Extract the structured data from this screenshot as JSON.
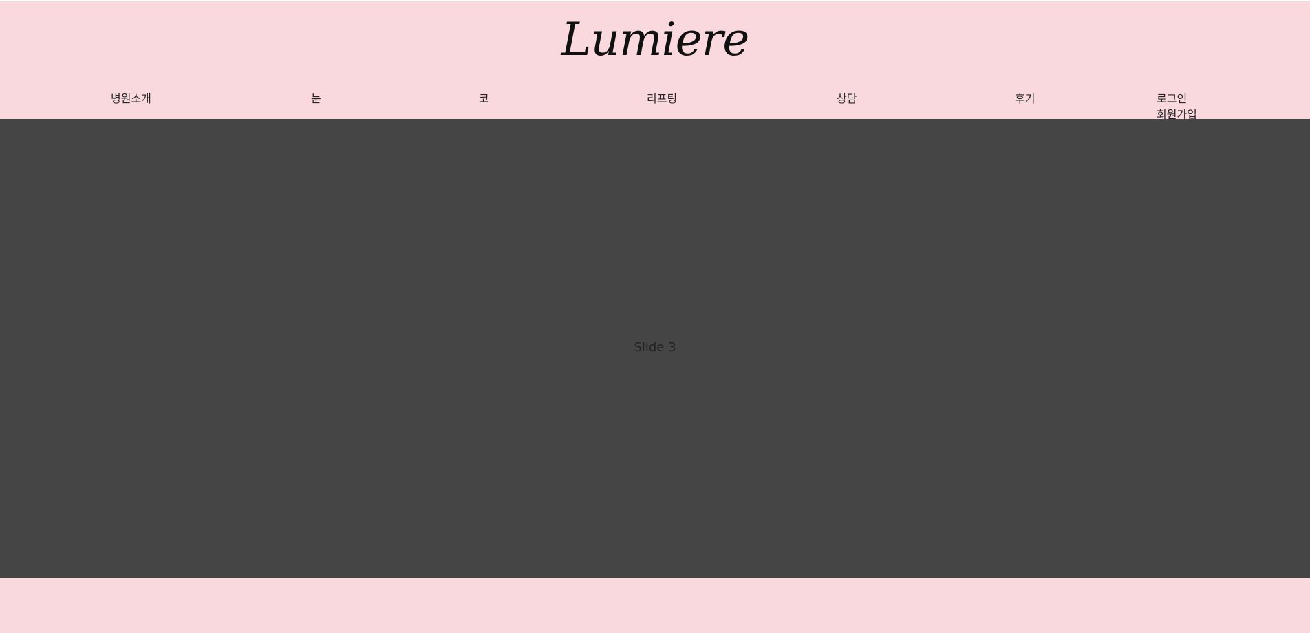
{
  "brand": {
    "logo_text": "Lumiere"
  },
  "nav": {
    "items": [
      {
        "label": "병원소개"
      },
      {
        "label": "눈"
      },
      {
        "label": "코"
      },
      {
        "label": "리프팅"
      },
      {
        "label": "상담"
      },
      {
        "label": "후기"
      }
    ]
  },
  "auth": {
    "login": "로그인",
    "signup": "회원가입"
  },
  "hero": {
    "slide_label": "Slide 3"
  },
  "colors": {
    "header_background": "#f9d9de",
    "hero_background": "#454545",
    "text": "#222222"
  }
}
